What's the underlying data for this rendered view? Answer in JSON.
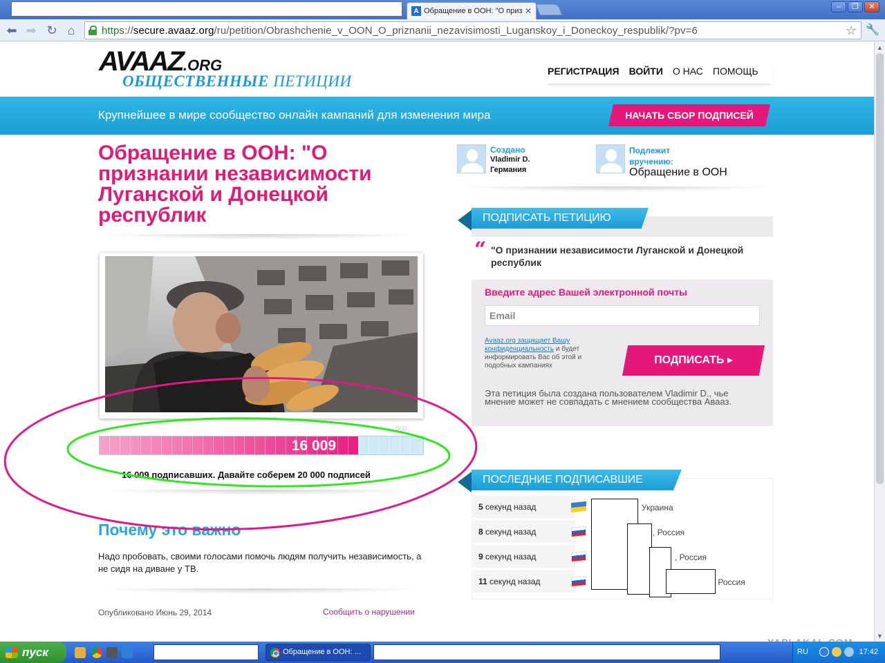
{
  "browser": {
    "tab_title": "Обращение в ООН: \"О приз",
    "tab_favicon": "A",
    "url_scheme": "https",
    "url_sep": "://",
    "url_host": "secure.avaaz.org",
    "url_path": "/ru/petition/Obrashchenie_v_OON_O_priznanii_nezavisimosti_Luganskoy_i_Doneckoy_respublik/?pv=6"
  },
  "header": {
    "logo_main": "AVAAZ",
    "logo_org": ".ORG",
    "logo_sub_bold": "ОБЩЕСТВЕННЫЕ",
    "logo_sub_rest": " ПЕТИЦИИ",
    "nav": [
      "РЕГИСТРАЦИЯ",
      "ВОЙТИ",
      "О НАС",
      "ПОМОЩЬ"
    ]
  },
  "banner": {
    "text": "Крупнейшее в мире сообщество онлайн кампаний для изменения мира",
    "button": "НАЧАТЬ СБОР ПОДПИСЕЙ"
  },
  "petition": {
    "title": "Обращение в ООН: \"О признании независимости Луганской и Донецкой республик",
    "count": "16 009",
    "goal_faint": "000",
    "progress_fraction": 0.8,
    "caption": "16 009 подписавших. Давайте соберем 20 000 подписей",
    "why_title": "Почему это важно",
    "why_text": "Надо пробовать, своими голосами помочь людям получить независимость, а не сидя на диване у ТВ.",
    "published": "Опубликовано Июнь 29, 2014",
    "report": "Сообщить о нарушении"
  },
  "creator": {
    "label": "Создано",
    "name": "Vladimir D.",
    "country": "Германия"
  },
  "recipient": {
    "label": "Подлежит вручению:",
    "value": "Обращение в ООН"
  },
  "sign": {
    "ribbon": "ПОДПИСАТЬ ПЕТИЦИЮ",
    "quote": "\"О признании независимости Луганской и Донецкой республик",
    "email_label": "Введите адрес Вашей электронной почты",
    "email_placeholder": "Email",
    "privacy_link": "Avaaz.org защищает Вашу конфиденциальность",
    "privacy_rest": " и будет информировать Вас об этой и подобных кампаниях",
    "button": "ПОДПИСАТЬ ▸",
    "disclaimer": "Эта петиция была создана пользователем Vladimir D., чье мнение может не совпадать с мнением сообщества Авааз."
  },
  "recent": {
    "ribbon": "ПОСЛЕДНИЕ ПОДПИСАВШИЕ",
    "rows": [
      {
        "time_num": "5",
        "time_rest": " секунд назад",
        "place": "Украина",
        "flag": "ua"
      },
      {
        "time_num": "8",
        "time_rest": " секунд назад",
        "place": ", Россия",
        "flag": "ru"
      },
      {
        "time_num": "9",
        "time_rest": " секунд назад",
        "place": ", Россия",
        "flag": "ru"
      },
      {
        "time_num": "11",
        "time_rest": " секунд назад",
        "place": "а, Россия",
        "flag": "ru"
      }
    ]
  },
  "taskbar": {
    "start": "пуск",
    "task_title": "Обращение в ООН: ...",
    "lang": "RU",
    "clock": "17:42"
  },
  "watermark": "YAPLAKAL.COM",
  "colors": {
    "brand_pink": "#e01a7a",
    "brand_blue": "#1a9bd7",
    "annotation_magenta": "#e0188a",
    "annotation_green": "#2ee81e"
  }
}
